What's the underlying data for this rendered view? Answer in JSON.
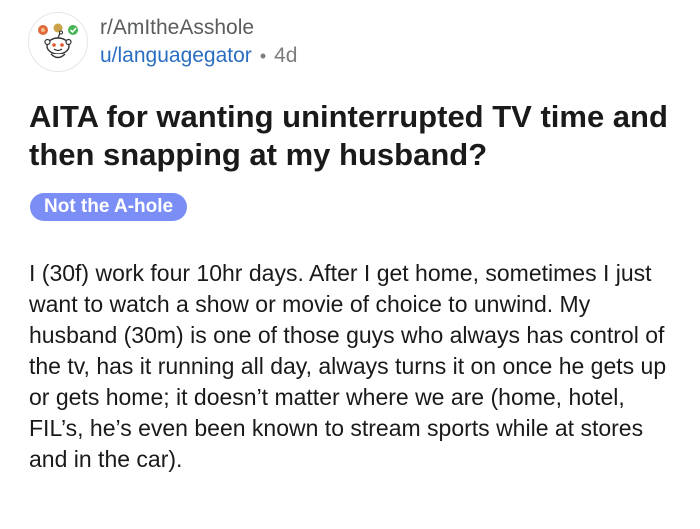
{
  "post": {
    "subreddit": "r/AmItheAsshole",
    "username": "u/languagegator",
    "separator": "•",
    "age": "4d",
    "avatar_icon": "reddit-snoo-icon",
    "title": "AITA for wanting uninterrupted TV time and then snapping at my husband?",
    "flair": "Not the A-hole",
    "body": "I (30f) work four 10hr days. After I get home, sometimes I just want to watch a show or movie of choice to unwind. My husband (30m) is one of those guys who always has control of the tv, has it running all day, always turns it on once he gets up or gets home; it doesn’t matter where we are (home, hotel, FIL’s, he’s even been known to stream sports while at stores and in the car)."
  },
  "colors": {
    "flair_bg": "#7b8ef5",
    "username": "#2a6ec2",
    "subreddit": "#5a5c5e",
    "meta_gray": "#7c7c7c",
    "text": "#1a1a1b"
  }
}
